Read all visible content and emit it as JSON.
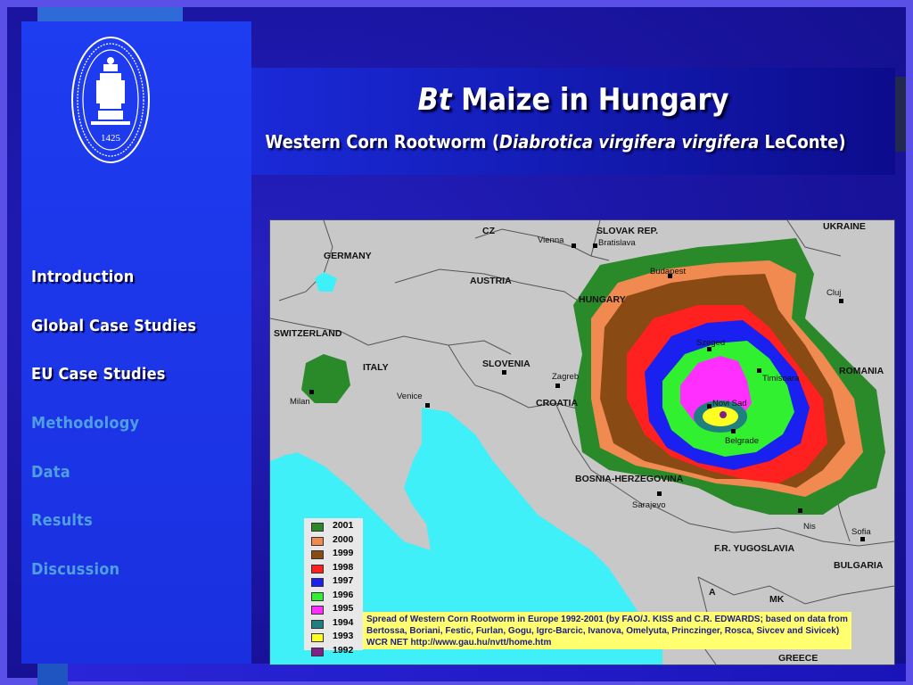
{
  "title": {
    "italic": "Bt",
    "rest": " Maize in Hungary"
  },
  "subtitle": {
    "before": "Western Corn Rootworm (",
    "italic": "Diabrotica virgifera virgifera",
    "after": " LeConte)"
  },
  "seal": {
    "year": "1425"
  },
  "nav": [
    {
      "label": "Introduction",
      "active": true
    },
    {
      "label": "Global Case Studies",
      "active": true
    },
    {
      "label": "EU Case Studies",
      "active": true
    },
    {
      "label": "Methodology",
      "active": false
    },
    {
      "label": "Data",
      "active": false
    },
    {
      "label": "Results",
      "active": false
    },
    {
      "label": "Discussion",
      "active": false
    }
  ],
  "map": {
    "countries": {
      "cz": "CZ",
      "slovak": "SLOVAK REP.",
      "ukraine": "UKRAINE",
      "germany": "GERMANY",
      "austria": "AUSTRIA",
      "hungary": "HUNGARY",
      "switzerland": "SWITZERLAND",
      "italy": "ITALY",
      "slovenia": "SLOVENIA",
      "croatia": "CROATIA",
      "romania": "ROMANIA",
      "bosnia": "BOSNIA-HERZEGOVINA",
      "yugoslavia": "F.R. YUGOSLAVIA",
      "bulgaria": "BULGARIA",
      "a": "A",
      "mk": "MK",
      "greece": "GREECE"
    },
    "cities": {
      "vienna": "Vienna",
      "bratislava": "Bratislava",
      "budapest": "Budapest",
      "cluj": "Cluj",
      "milan": "Milan",
      "venice": "Venice",
      "zagreb": "Zagreb",
      "szeged": "Szeged",
      "timisoara": "Timisoara",
      "novisad": "Novi Sad",
      "belgrade": "Belgrade",
      "sarajevo": "Sarajevo",
      "nis": "Nis",
      "sofia": "Sofia"
    },
    "legend": [
      {
        "year": "2001",
        "color": "#2a8a2a"
      },
      {
        "year": "2000",
        "color": "#f08a50"
      },
      {
        "year": "1999",
        "color": "#8a4a14"
      },
      {
        "year": "1998",
        "color": "#ff2020"
      },
      {
        "year": "1997",
        "color": "#1a20f0"
      },
      {
        "year": "1996",
        "color": "#30f030"
      },
      {
        "year": "1995",
        "color": "#ff30ff"
      },
      {
        "year": "1994",
        "color": "#208080"
      },
      {
        "year": "1993",
        "color": "#ffff20"
      },
      {
        "year": "1992",
        "color": "#80208a"
      }
    ],
    "caption": {
      "line1": "Spread of Western Corn Rootworm in Europe 1992-2001 (by FAO/J. KISS and C.R. EDWARDS; based on data from",
      "line2": "Bertossa, Boriani, Festic, Furlan, Gogu, Igrc-Barcic, Ivanova, Omelyuta, Princzinger, Rosca, Sivcev and Sivicek)",
      "line3": "WCR NET http://www.gau.hu/nvtt/home.htm"
    },
    "colors": {
      "land": "#c8c8c8",
      "sea": "#40f0f8",
      "border": "#555555"
    }
  }
}
